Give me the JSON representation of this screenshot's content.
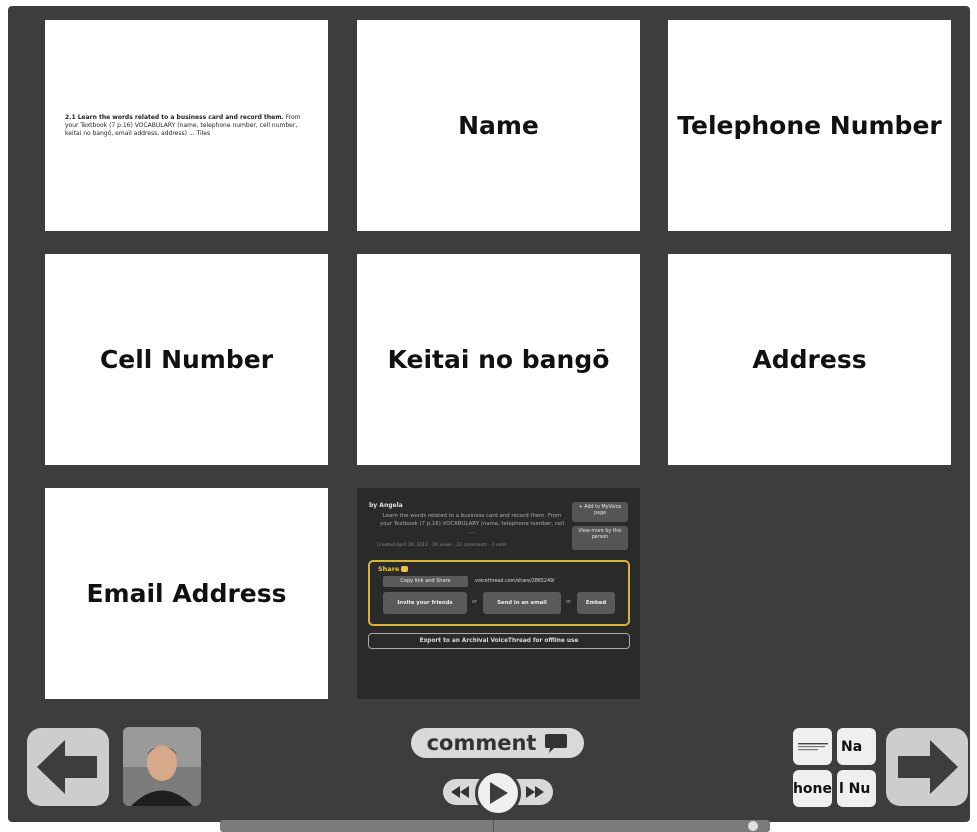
{
  "tiles": {
    "t1": {
      "instruction_heading": "2.1 Learn the words related to a business card and record them.",
      "instruction_body": "From your Textbook (7 p.16) VOCABULARY (name, telephone number, cell number, keitai no bangō, email address, address) ... Tiles"
    },
    "t2": {
      "title": "Name"
    },
    "t3": {
      "title": "Telephone Number"
    },
    "t4": {
      "title": "Cell Number"
    },
    "t5": {
      "title": "Keitai no bangō"
    },
    "t6": {
      "title": "Address"
    },
    "t7": {
      "title": "Email Address"
    }
  },
  "share_panel": {
    "by": "by Angela",
    "description": "Learn the words related to a business card and record them. From your Textbook (7 p.16) VOCABULARY (name, telephone number, cell ...",
    "meta": "Created April 28, 2012 · 26 views · 22 comments · 1 vote",
    "add_button": "+ Add to MyVoice page",
    "view_more_button": "View more by this person",
    "share_label": "Share",
    "copy_link_button": "Copy link and Share",
    "url": "voicethread.com/share/2865249/",
    "invite_button": "Invite your friends",
    "or1": "or",
    "send_email_button": "Send in an email",
    "or2": "or",
    "embed_button": "Embed",
    "export_button": "Export to an Archival VoiceThread for offline use"
  },
  "controls": {
    "comment_label": "comment",
    "prev_icon": "left-arrow-icon",
    "next_icon": "right-arrow-icon",
    "rewind_icon": "rewind-icon",
    "play_icon": "play-icon",
    "forward_icon": "fast-forward-icon",
    "comment_icon": "speech-bubble-icon"
  },
  "thumbnails": {
    "th2": "Na",
    "th3": "hone",
    "th4": "l Nu"
  },
  "colors": {
    "frame_bg": "#3d3d3d",
    "tile_bg": "#ffffff",
    "control_bg": "#cdcdcd",
    "share_accent": "#d9b23a"
  }
}
